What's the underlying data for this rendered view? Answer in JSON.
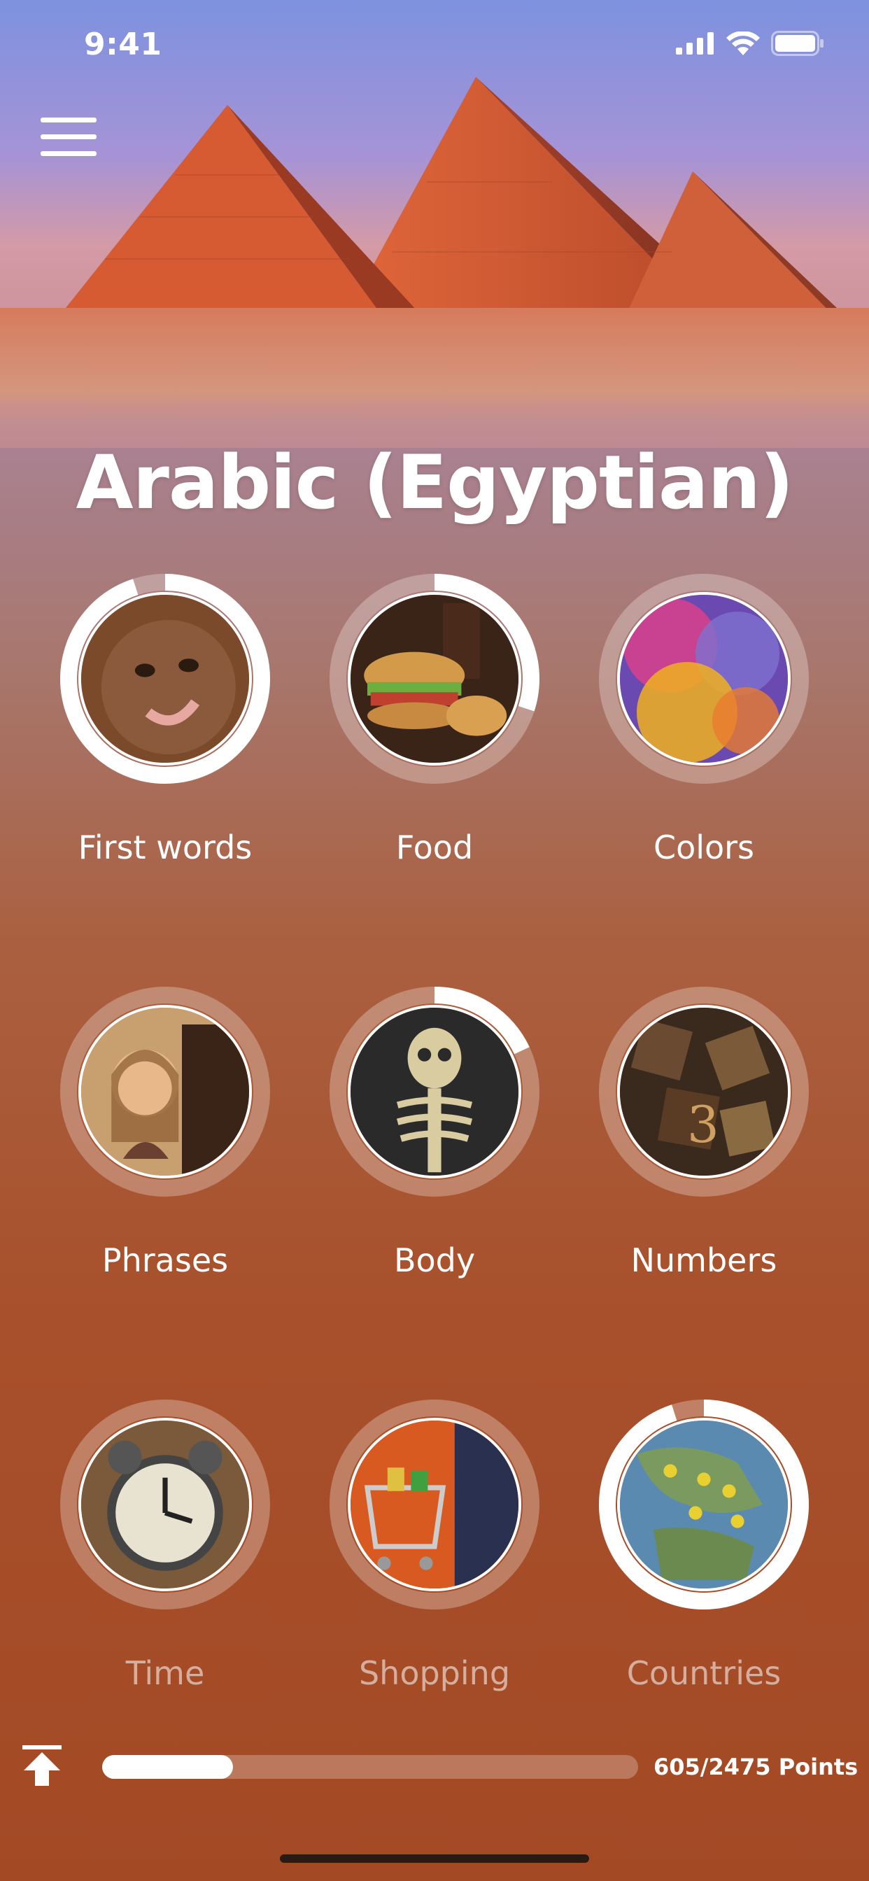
{
  "status": {
    "time": "9:41"
  },
  "title": "Arabic (Egyptian)",
  "categories": [
    {
      "label": "First words",
      "progress": 0.95,
      "dim": false,
      "icon": "baby-photo"
    },
    {
      "label": "Food",
      "progress": 0.3,
      "dim": false,
      "icon": "food-photo"
    },
    {
      "label": "Colors",
      "progress": 0,
      "dim": false,
      "icon": "colors-photo"
    },
    {
      "label": "Phrases",
      "progress": 0,
      "dim": false,
      "icon": "phrases-photo"
    },
    {
      "label": "Body",
      "progress": 0.18,
      "dim": false,
      "icon": "skeleton-photo"
    },
    {
      "label": "Numbers",
      "progress": 0,
      "dim": false,
      "icon": "numbers-photo"
    },
    {
      "label": "Time",
      "progress": 0,
      "dim": true,
      "icon": "clock-photo"
    },
    {
      "label": "Shopping",
      "progress": 0,
      "dim": true,
      "icon": "shopping-photo"
    },
    {
      "label": "Countries",
      "progress": 0.95,
      "dim": true,
      "icon": "map-photo"
    }
  ],
  "points": {
    "current": 605,
    "total": 2475,
    "label": "605/2475 Points"
  },
  "colors": {
    "ring_track": "#ffffff55",
    "ring_fill": "#ffffff"
  }
}
